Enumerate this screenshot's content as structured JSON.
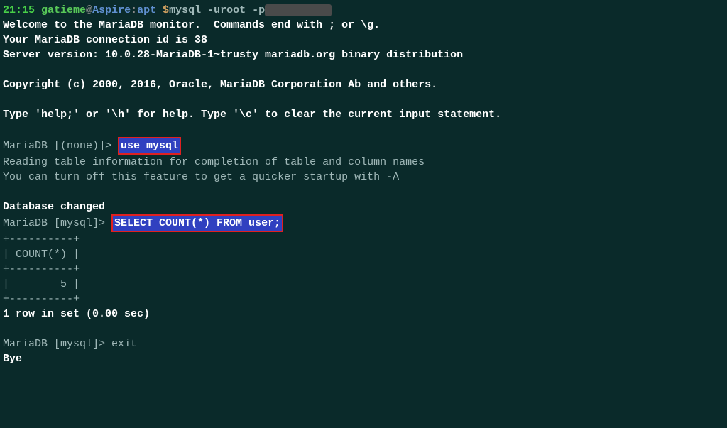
{
  "prompt": {
    "time": "21:15",
    "user": "gatieme",
    "at": "@",
    "host": "Aspire",
    "sep": ":",
    "path": "apt",
    "dollar": " $",
    "command": "mysql -uroot -p",
    "redacted": "          "
  },
  "lines": {
    "l1": "Welcome to the MariaDB monitor.  Commands end with ; or \\g.",
    "l2": "Your MariaDB connection id is 38",
    "l3": "Server version: 10.0.28-MariaDB-1~trusty mariadb.org binary distribution",
    "l4": "Copyright (c) 2000, 2016, Oracle, MariaDB Corporation Ab and others.",
    "l5": "Type 'help;' or '\\h' for help. Type '\\c' to clear the current input statement."
  },
  "mariadb": {
    "prompt_none": "MariaDB [(none)]> ",
    "cmd1": "use mysql",
    "reading1": "Reading table information for completion of table and column names",
    "reading2": "You can turn off this feature to get a quicker startup with -A",
    "db_changed": "Database changed",
    "prompt_mysql": "MariaDB [mysql]> ",
    "cmd2": "SELECT COUNT(*) FROM user;",
    "table_border": "+----------+",
    "table_header": "| COUNT(*) |",
    "table_row": "|        5 |",
    "result_summary": "1 row in set (0.00 sec)",
    "cmd3": "exit",
    "bye": "Bye"
  }
}
